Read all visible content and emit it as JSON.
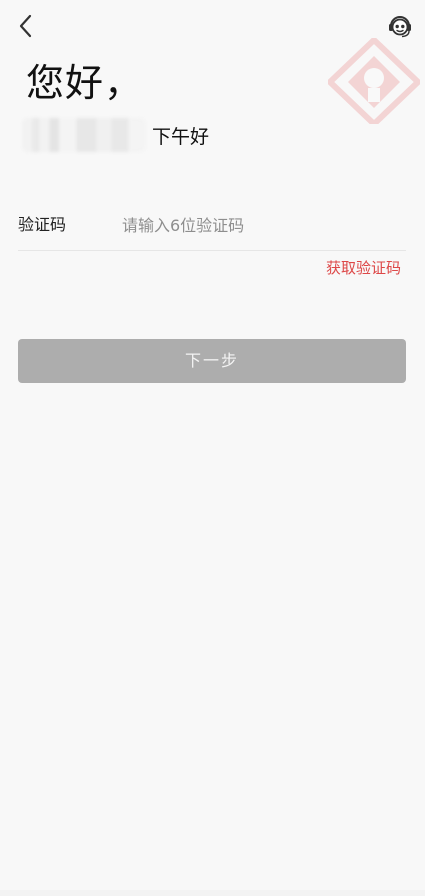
{
  "header": {
    "back_icon": "chevron-left-icon",
    "support_icon": "customer-service-icon",
    "logo": "bank-logo-watermark"
  },
  "greeting": {
    "title": "您好，",
    "time_greeting": "下午好"
  },
  "form": {
    "code_label": "验证码",
    "code_placeholder": "请输入6位验证码",
    "code_value": "",
    "get_code_label": "获取验证码"
  },
  "actions": {
    "next_label": "下一步"
  },
  "colors": {
    "accent": "#dd4848",
    "button_disabled": "#adadad",
    "background": "#f8f8f8"
  }
}
